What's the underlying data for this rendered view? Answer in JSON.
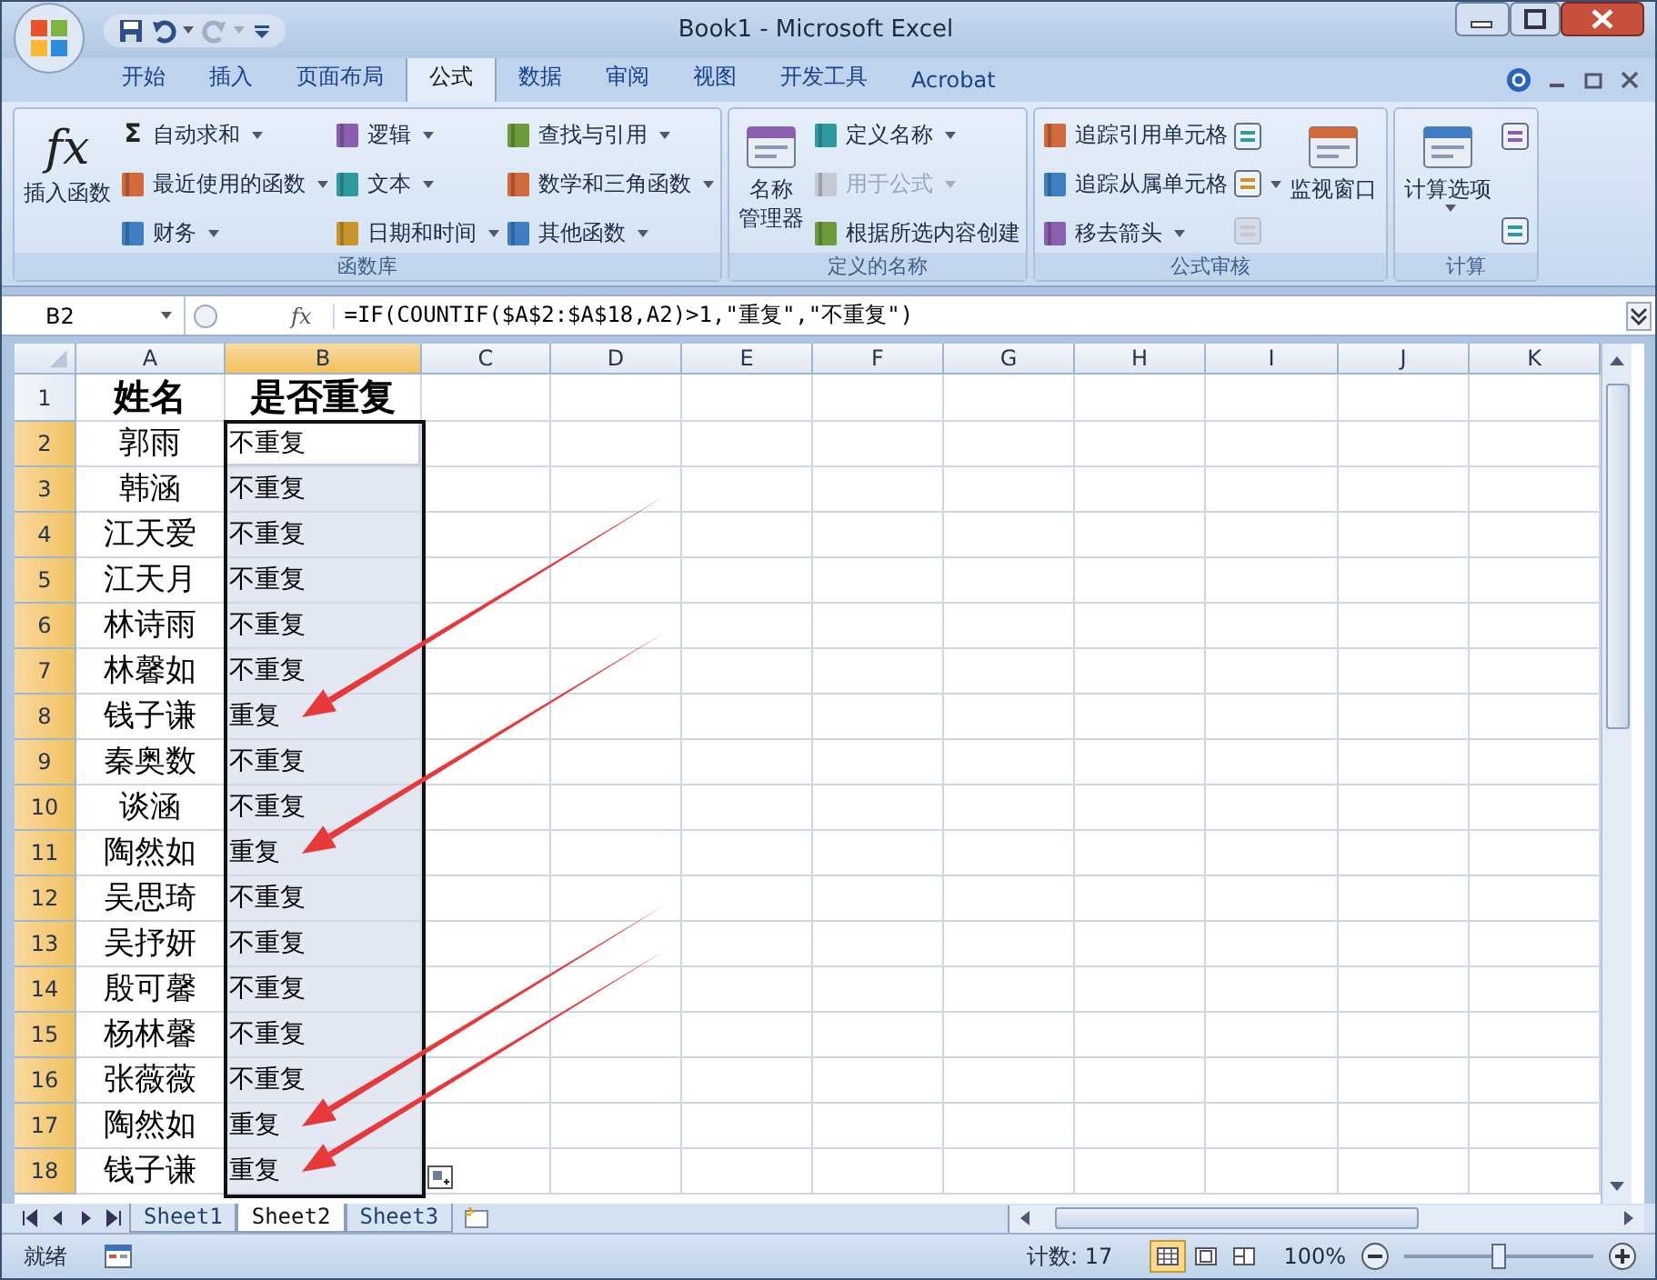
{
  "window": {
    "title": "Book1 - Microsoft Excel"
  },
  "quick_access": [
    {
      "kind": "save",
      "dropdown": false,
      "disabled": false
    },
    {
      "kind": "undo",
      "dropdown": true,
      "disabled": false
    },
    {
      "kind": "redo",
      "dropdown": true,
      "disabled": true
    },
    {
      "kind": "customize",
      "dropdown": false,
      "disabled": false
    }
  ],
  "tabs": [
    {
      "label": "开始",
      "selected": false
    },
    {
      "label": "插入",
      "selected": false
    },
    {
      "label": "页面布局",
      "selected": false
    },
    {
      "label": "公式",
      "selected": true
    },
    {
      "label": "数据",
      "selected": false
    },
    {
      "label": "审阅",
      "selected": false
    },
    {
      "label": "视图",
      "selected": false
    },
    {
      "label": "开发工具",
      "selected": false
    },
    {
      "label": "Acrobat",
      "selected": false
    }
  ],
  "ribbon_groups": [
    {
      "label": "函数库",
      "columns": [
        {
          "kind": "large",
          "items": [
            {
              "glyph": "fx",
              "lines": [
                "插入函数"
              ],
              "dropdown": false,
              "disabled": false
            }
          ]
        },
        {
          "kind": "small",
          "items": [
            {
              "glyph": "Σ",
              "label": "自动求和",
              "dropdown": true,
              "disabled": false
            },
            {
              "label": "最近使用的函数",
              "dropdown": true,
              "disabled": false
            },
            {
              "label": "财务",
              "dropdown": true,
              "disabled": false
            }
          ]
        },
        {
          "kind": "small",
          "items": [
            {
              "label": "逻辑",
              "dropdown": true,
              "disabled": false
            },
            {
              "label": "文本",
              "dropdown": true,
              "disabled": false
            },
            {
              "label": "日期和时间",
              "dropdown": true,
              "disabled": false
            }
          ]
        },
        {
          "kind": "small",
          "items": [
            {
              "label": "查找与引用",
              "dropdown": true,
              "disabled": false
            },
            {
              "label": "数学和三角函数",
              "dropdown": true,
              "disabled": false
            },
            {
              "label": "其他函数",
              "dropdown": true,
              "disabled": false
            }
          ]
        }
      ]
    },
    {
      "label": "定义的名称",
      "columns": [
        {
          "kind": "large",
          "items": [
            {
              "lines": [
                "名称",
                "管理器"
              ],
              "dropdown": false,
              "disabled": false
            }
          ]
        },
        {
          "kind": "small",
          "items": [
            {
              "label": "定义名称",
              "dropdown": true,
              "disabled": false
            },
            {
              "label": "用于公式",
              "dropdown": true,
              "disabled": true
            },
            {
              "label": "根据所选内容创建",
              "dropdown": false,
              "disabled": false
            }
          ]
        }
      ]
    },
    {
      "label": "公式审核",
      "columns": [
        {
          "kind": "small",
          "items": [
            {
              "label": "追踪引用单元格",
              "dropdown": false,
              "disabled": false
            },
            {
              "label": "追踪从属单元格",
              "dropdown": false,
              "disabled": false
            },
            {
              "label": "移去箭头",
              "dropdown": true,
              "disabled": false
            }
          ]
        },
        {
          "kind": "icons",
          "items": [
            {
              "dropdown": false,
              "disabled": false
            },
            {
              "dropdown": true,
              "disabled": false
            },
            {
              "dropdown": false,
              "disabled": true
            }
          ]
        },
        {
          "kind": "large",
          "items": [
            {
              "lines": [
                "监视窗口"
              ],
              "dropdown": false,
              "disabled": false
            }
          ]
        }
      ]
    },
    {
      "label": "计算",
      "columns": [
        {
          "kind": "large",
          "items": [
            {
              "lines": [
                "计算选项"
              ],
              "dropdown": true,
              "disabled": false
            }
          ]
        },
        {
          "kind": "icons",
          "items": [
            {
              "dropdown": false,
              "disabled": false
            },
            {
              "dropdown": false,
              "disabled": false
            }
          ]
        }
      ]
    }
  ],
  "formula_bar": {
    "name_box": "B2",
    "fx": "fx",
    "formula": "=IF(COUNTIF($A$2:$A$18,A2)>1,\"重复\",\"不重复\")"
  },
  "columns": [
    {
      "label": "A",
      "selected": false
    },
    {
      "label": "B",
      "selected": true
    },
    {
      "label": "C",
      "selected": false
    },
    {
      "label": "D",
      "selected": false
    },
    {
      "label": "E",
      "selected": false
    },
    {
      "label": "F",
      "selected": false
    },
    {
      "label": "G",
      "selected": false
    },
    {
      "label": "H",
      "selected": false
    },
    {
      "label": "I",
      "selected": false
    },
    {
      "label": "J",
      "selected": false
    },
    {
      "label": "K",
      "selected": false
    }
  ],
  "rows": [
    {
      "row": "1",
      "kind": "header",
      "name": "姓名",
      "result": "是否重复",
      "selected": false,
      "active": false,
      "arrow": false
    },
    {
      "row": "2",
      "kind": "data",
      "name": "郭雨",
      "result": "不重复",
      "selected": true,
      "active": true,
      "arrow": false
    },
    {
      "row": "3",
      "kind": "data",
      "name": "韩涵",
      "result": "不重复",
      "selected": true,
      "active": false,
      "arrow": false
    },
    {
      "row": "4",
      "kind": "data",
      "name": "江天爱",
      "result": "不重复",
      "selected": true,
      "active": false,
      "arrow": false
    },
    {
      "row": "5",
      "kind": "data",
      "name": "江天月",
      "result": "不重复",
      "selected": true,
      "active": false,
      "arrow": false
    },
    {
      "row": "6",
      "kind": "data",
      "name": "林诗雨",
      "result": "不重复",
      "selected": true,
      "active": false,
      "arrow": false
    },
    {
      "row": "7",
      "kind": "data",
      "name": "林馨如",
      "result": "不重复",
      "selected": true,
      "active": false,
      "arrow": false
    },
    {
      "row": "8",
      "kind": "data",
      "name": "钱子谦",
      "result": "重复",
      "selected": true,
      "active": false,
      "arrow": true
    },
    {
      "row": "9",
      "kind": "data",
      "name": "秦奥数",
      "result": "不重复",
      "selected": true,
      "active": false,
      "arrow": false
    },
    {
      "row": "10",
      "kind": "data",
      "name": "谈涵",
      "result": "不重复",
      "selected": true,
      "active": false,
      "arrow": false
    },
    {
      "row": "11",
      "kind": "data",
      "name": "陶然如",
      "result": "重复",
      "selected": true,
      "active": false,
      "arrow": true
    },
    {
      "row": "12",
      "kind": "data",
      "name": "吴思琦",
      "result": "不重复",
      "selected": true,
      "active": false,
      "arrow": false
    },
    {
      "row": "13",
      "kind": "data",
      "name": "吴抒妍",
      "result": "不重复",
      "selected": true,
      "active": false,
      "arrow": false
    },
    {
      "row": "14",
      "kind": "data",
      "name": "殷可馨",
      "result": "不重复",
      "selected": true,
      "active": false,
      "arrow": false
    },
    {
      "row": "15",
      "kind": "data",
      "name": "杨林馨",
      "result": "不重复",
      "selected": true,
      "active": false,
      "arrow": false
    },
    {
      "row": "16",
      "kind": "data",
      "name": "张薇薇",
      "result": "不重复",
      "selected": true,
      "active": false,
      "arrow": false
    },
    {
      "row": "17",
      "kind": "data",
      "name": "陶然如",
      "result": "重复",
      "selected": true,
      "active": false,
      "arrow": true
    },
    {
      "row": "18",
      "kind": "data",
      "name": "钱子谦",
      "result": "重复",
      "selected": true,
      "active": false,
      "arrow": true
    }
  ],
  "sheets": [
    {
      "label": "Sheet1",
      "selected": false
    },
    {
      "label": "Sheet2",
      "selected": true
    },
    {
      "label": "Sheet3",
      "selected": false
    }
  ],
  "status_bar": {
    "mode": "就绪",
    "count": "计数: 17",
    "views": [
      {
        "selected": true
      },
      {
        "selected": false
      },
      {
        "selected": false
      }
    ],
    "zoom": "100%",
    "zoom_level": {
      "level": 0.5
    }
  }
}
